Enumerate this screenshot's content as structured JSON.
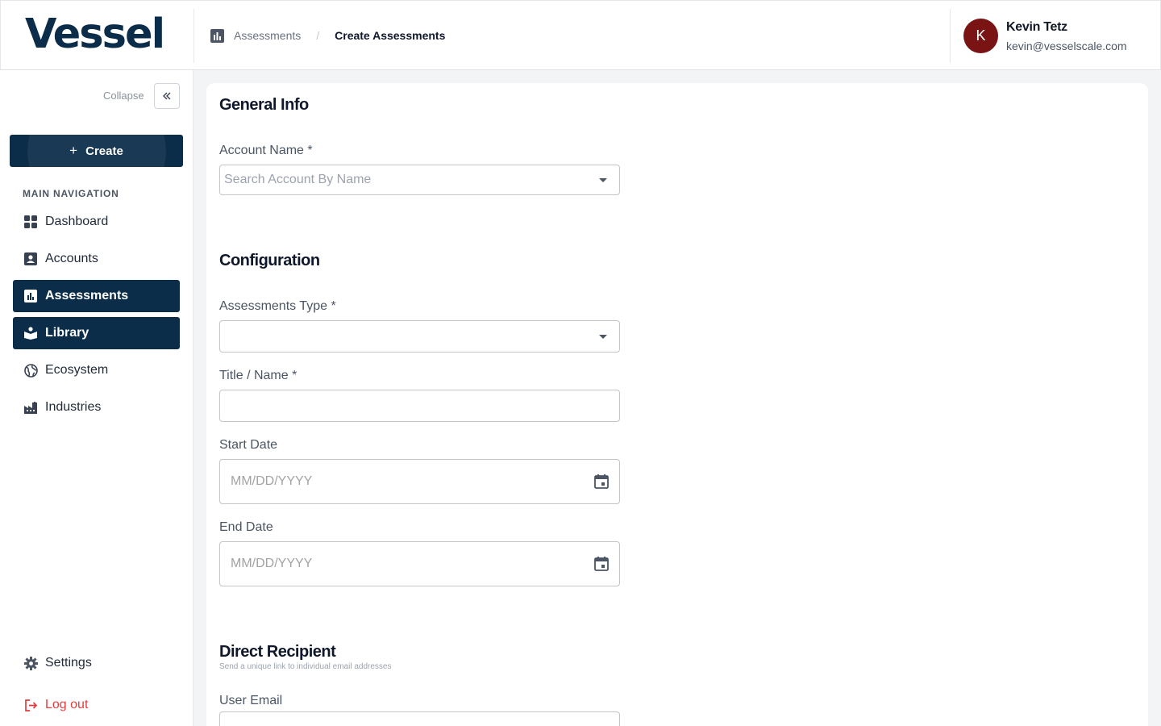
{
  "header": {
    "logo": "Vessel",
    "breadcrumb": {
      "parent": "Assessments",
      "separator": "/",
      "current": "Create Assessments"
    },
    "user": {
      "initial": "K",
      "name": "Kevin Tetz",
      "email": "kevin@vesselscale.com"
    }
  },
  "sidebar": {
    "collapse_label": "Collapse",
    "create_label": "Create",
    "nav_heading": "MAIN NAVIGATION",
    "items": [
      {
        "label": "Dashboard",
        "icon": "grid-icon",
        "active": false
      },
      {
        "label": "Accounts",
        "icon": "account-box-icon",
        "active": false
      },
      {
        "label": "Assessments",
        "icon": "chart-icon",
        "active": true
      },
      {
        "label": "Library",
        "icon": "book-icon",
        "active": true
      },
      {
        "label": "Ecosystem",
        "icon": "globe-icon",
        "active": false
      },
      {
        "label": "Industries",
        "icon": "factory-icon",
        "active": false
      }
    ],
    "settings_label": "Settings",
    "logout_label": "Log out"
  },
  "form": {
    "general_info": {
      "title": "General Info",
      "account_name_label": "Account Name",
      "required_mark": "*",
      "account_name_placeholder": "Search Account By Name"
    },
    "configuration": {
      "title": "Configuration",
      "type_label": "Assessments Type",
      "type_value": "",
      "title_label": "Title / Name",
      "title_value": "",
      "start_label": "Start Date",
      "start_placeholder": "MM/DD/YYYY",
      "end_label": "End Date",
      "end_placeholder": "MM/DD/YYYY"
    },
    "direct_recipient": {
      "title": "Direct Recipient",
      "subtitle": "Send a unique link to individual email addresses",
      "email_label": "User Email",
      "email_value": ""
    }
  },
  "colors": {
    "brand": "#0b2d4a",
    "avatar": "#7a1414",
    "logout": "#e23d3d",
    "page_bg": "#f3f4f6"
  }
}
